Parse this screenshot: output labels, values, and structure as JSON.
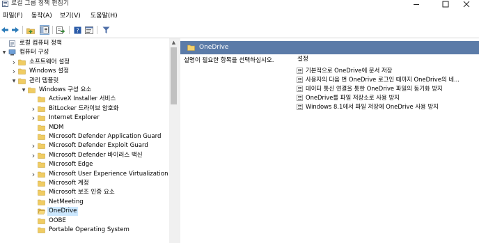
{
  "window": {
    "title": "로컬 그룹 정책 편집기",
    "app_icon": "group-policy-icon",
    "controls": [
      "minimize-icon",
      "maximize-icon",
      "close-icon"
    ]
  },
  "menu": {
    "file": "파일(F)",
    "action": "동작(A)",
    "view": "보기(V)",
    "help": "도움말(H)"
  },
  "toolbar": {
    "icons": [
      "back-arrow-icon",
      "forward-arrow-icon",
      "up-folder-icon",
      "show-hide-tree-icon",
      "export-list-icon",
      "help-icon",
      "properties-icon",
      "filter-icon"
    ]
  },
  "tree": {
    "items": [
      {
        "label": "로컬 컴퓨터 정책",
        "expander": "",
        "icon": "policy-document"
      },
      {
        "label": "컴퓨터 구성",
        "expander": "▼",
        "icon": "computer"
      },
      {
        "label": "소프트웨어 설정",
        "expander": "›",
        "icon": "folder"
      },
      {
        "label": "Windows 설정",
        "expander": "›",
        "icon": "folder"
      },
      {
        "label": "관리 템플릿",
        "expander": "▼",
        "icon": "folder"
      },
      {
        "label": "Windows 구성 요소",
        "expander": "▼",
        "icon": "folder"
      },
      {
        "label": "ActiveX Installer 서비스",
        "expander": "",
        "icon": "folder"
      },
      {
        "label": "BitLocker 드라이브 암호화",
        "expander": "›",
        "icon": "folder"
      },
      {
        "label": "Internet Explorer",
        "expander": "›",
        "icon": "folder"
      },
      {
        "label": "MDM",
        "expander": "",
        "icon": "folder"
      },
      {
        "label": "Microsoft Defender Application Guard",
        "expander": "",
        "icon": "folder"
      },
      {
        "label": "Microsoft Defender Exploit Guard",
        "expander": "›",
        "icon": "folder"
      },
      {
        "label": "Microsoft Defender 바이러스 백신",
        "expander": "›",
        "icon": "folder"
      },
      {
        "label": "Microsoft Edge",
        "expander": "",
        "icon": "folder"
      },
      {
        "label": "Microsoft User Experience Virtualization",
        "expander": "›",
        "icon": "folder"
      },
      {
        "label": "Microsoft 계정",
        "expander": "",
        "icon": "folder"
      },
      {
        "label": "Microsoft 보조 인증 요소",
        "expander": "",
        "icon": "folder"
      },
      {
        "label": "NetMeeting",
        "expander": "",
        "icon": "folder"
      },
      {
        "label": "OneDrive",
        "expander": "",
        "icon": "folder-open",
        "selected": true
      },
      {
        "label": "OOBE",
        "expander": "",
        "icon": "folder"
      },
      {
        "label": "Portable Operating System",
        "expander": "",
        "icon": "folder"
      }
    ]
  },
  "details": {
    "header": "OneDrive",
    "description": "설명이 필요한 항목을 선택하십시오.",
    "column_header": "설정",
    "settings": [
      "기본적으로 OneDrive에 문서 저장",
      "사용자의 다음 번 OneDrive 로그인 때까지 OneDrive의 네...",
      "데이터 통신 연결을 통한 OneDrive 파일의 동기화 방지",
      "OneDrive를 파일 저장소로 사용 방지",
      "Windows 8.1에서 파일 저장에 OneDrive 사용 방지"
    ]
  },
  "colors": {
    "header_band": "#5b7ba8",
    "selection": "#cce8ff",
    "folder": "#e8c25a"
  }
}
